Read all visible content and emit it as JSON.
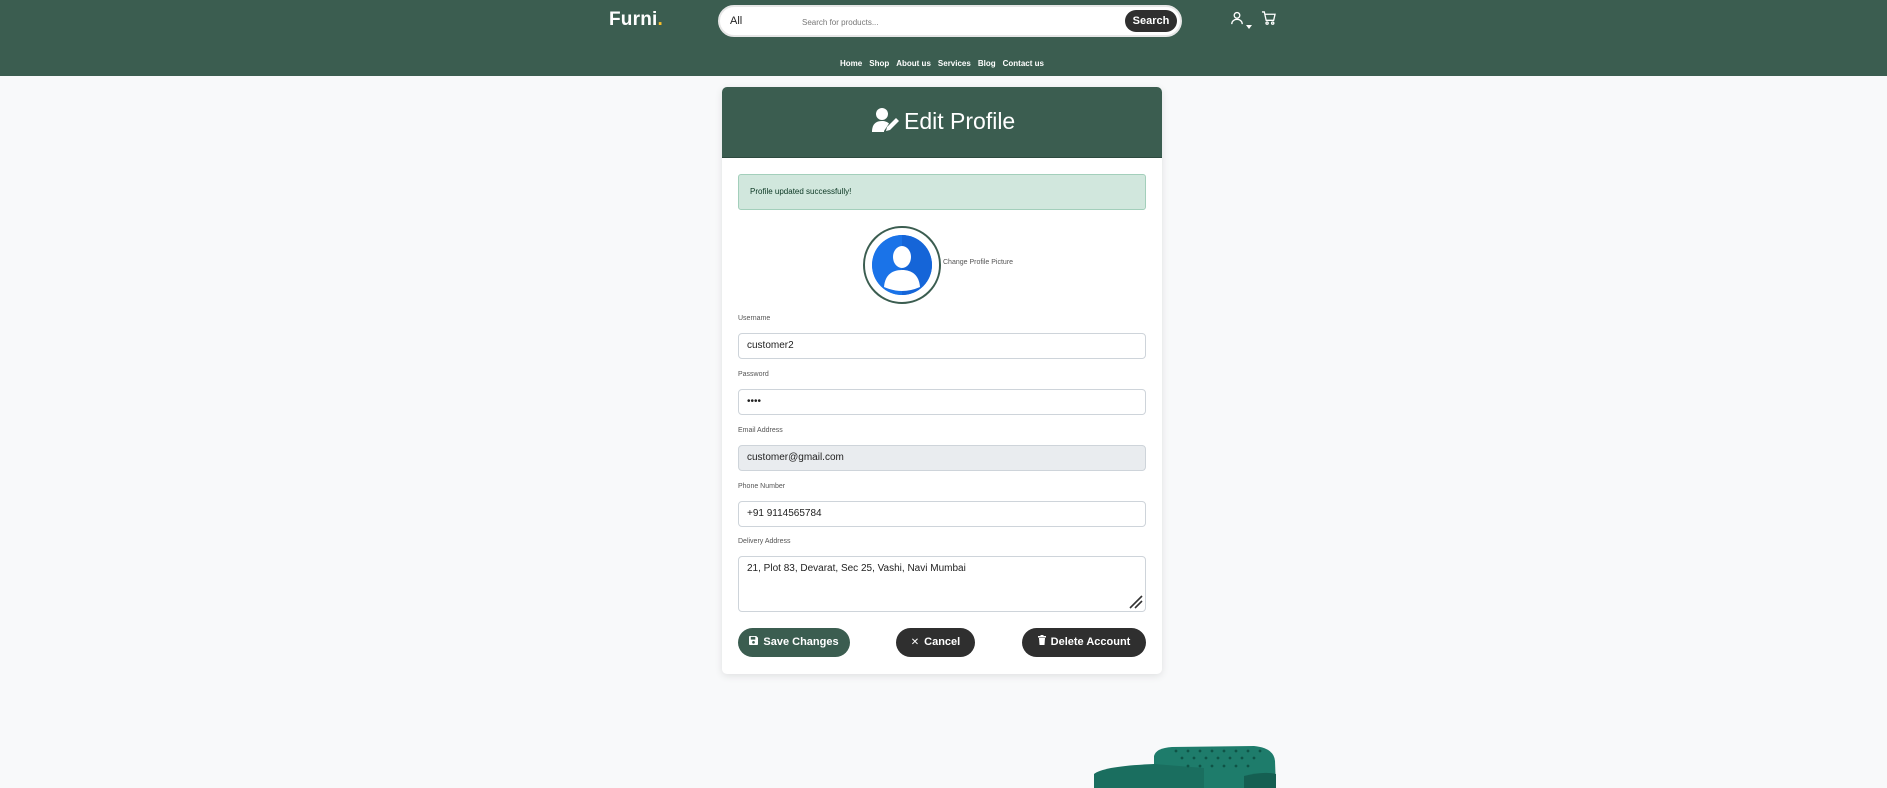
{
  "header": {
    "brand": "Furni",
    "brand_dot": ".",
    "search": {
      "category": "All",
      "placeholder": "Search for products...",
      "button_label": "Search"
    },
    "nav": [
      "Home",
      "Shop",
      "About us",
      "Services",
      "Blog",
      "Contact us"
    ],
    "icons": [
      "user-icon",
      "caret-down-icon",
      "cart-icon"
    ]
  },
  "card": {
    "title": "Edit Profile",
    "title_icon": "user-edit-icon",
    "alert": "Profile updated successfully!",
    "change_picture_label": "Change Profile Picture",
    "fields": {
      "username": {
        "label": "Username",
        "value": "customer2"
      },
      "password": {
        "label": "Password",
        "value": "••••"
      },
      "email": {
        "label": "Email Address",
        "value": "customer@gmail.com"
      },
      "phone": {
        "label": "Phone Number",
        "value": "+91 9114565784"
      },
      "address": {
        "label": "Delivery Address",
        "value": "21, Plot 83, Devarat, Sec 25, Vashi, Navi Mumbai"
      }
    },
    "buttons": {
      "save": {
        "label": "Save Changes",
        "icon": "floppy-disk-icon"
      },
      "cancel": {
        "label": "Cancel",
        "icon": "close-icon"
      },
      "delete": {
        "label": "Delete Account",
        "icon": "trash-icon"
      }
    }
  },
  "colors": {
    "primary_green": "#3b5d50",
    "dark_button": "#2f2f2f",
    "alert_bg": "#d1e7dd",
    "avatar_blue": "#1a73e8",
    "brand_accent": "#f9bf29",
    "page_bg": "#f8f9fa"
  }
}
